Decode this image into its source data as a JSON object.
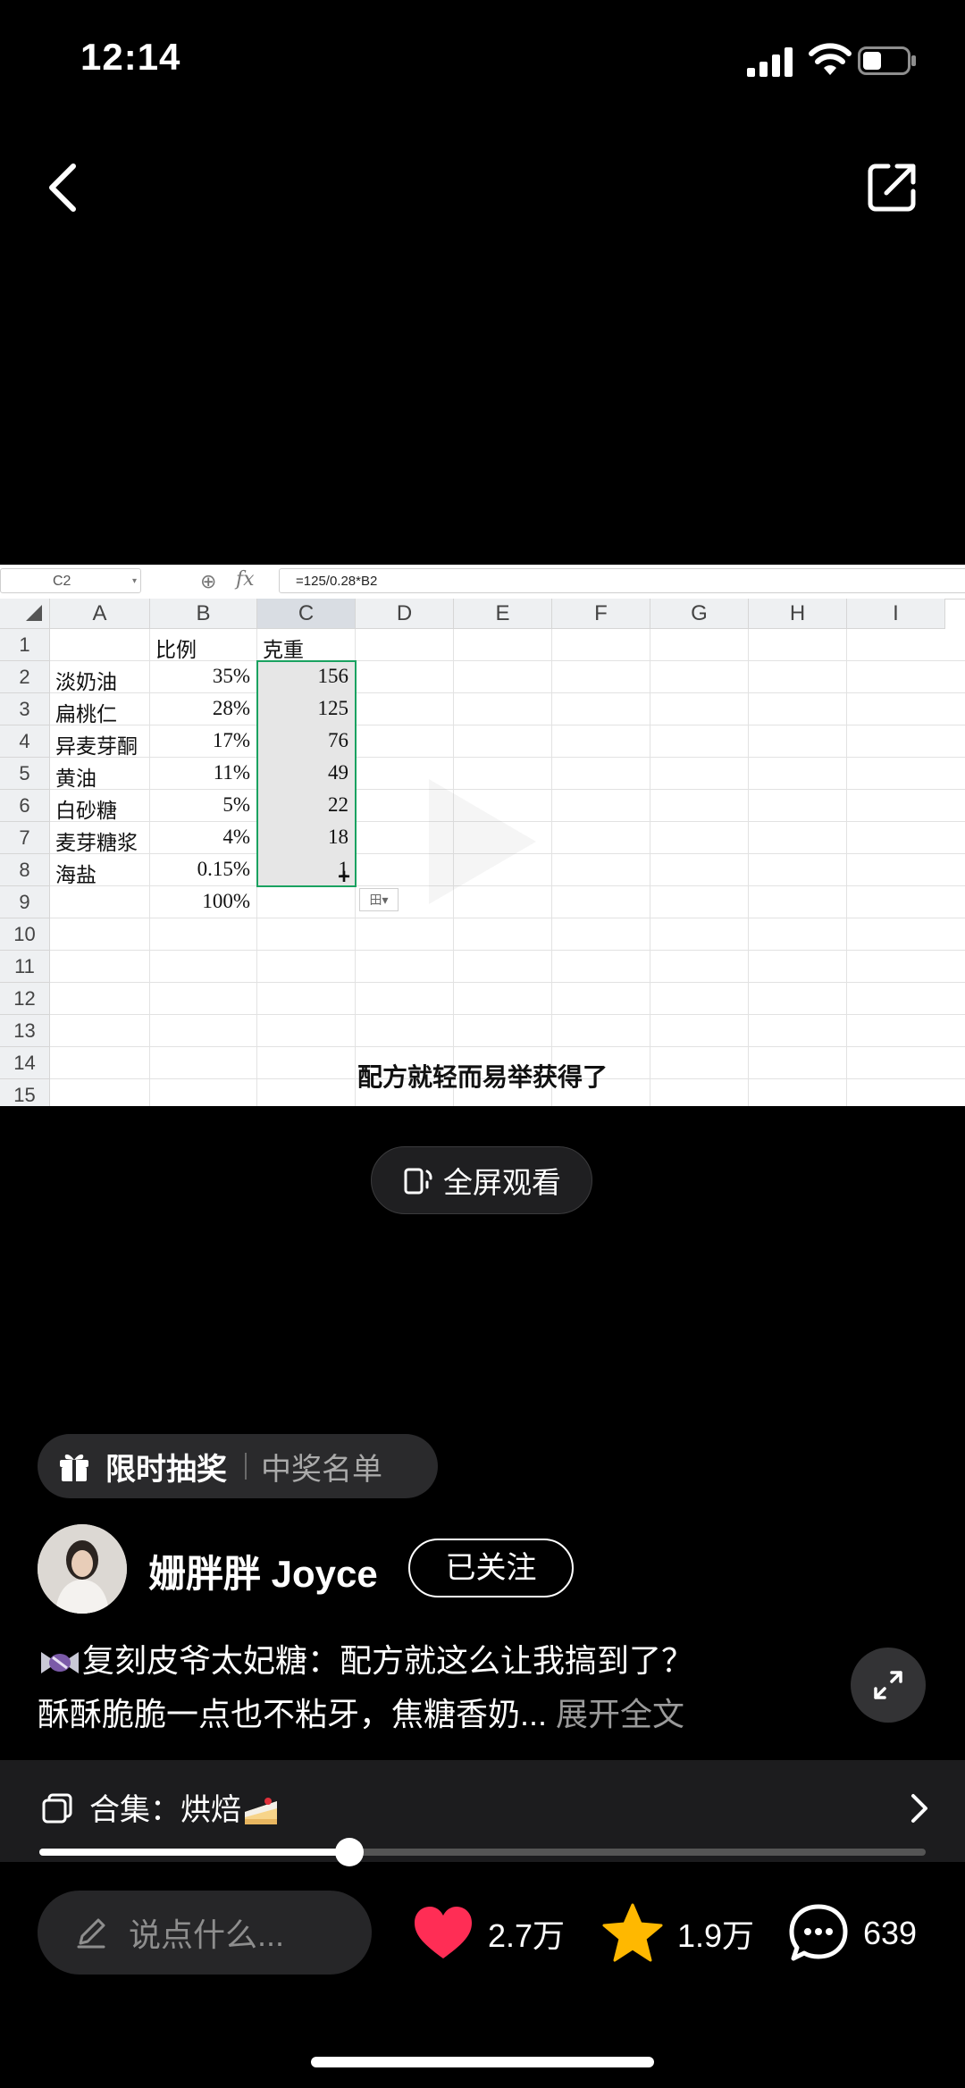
{
  "status": {
    "time": "12:14"
  },
  "sheet": {
    "name_box": "C2",
    "formula": "=125/0.28*B2",
    "fx_label": "fx",
    "columns": [
      "A",
      "B",
      "C",
      "D",
      "E",
      "F",
      "G",
      "H",
      "I"
    ],
    "rows": [
      "1",
      "2",
      "3",
      "4",
      "5",
      "6",
      "7",
      "8",
      "9",
      "10",
      "11",
      "12",
      "13",
      "14",
      "15"
    ],
    "header_row": {
      "b": "比例",
      "c": "克重"
    },
    "data": [
      {
        "a": "淡奶油",
        "b": "35%",
        "c": "156"
      },
      {
        "a": "扁桃仁",
        "b": "28%",
        "c": "125"
      },
      {
        "a": "异麦芽酮",
        "b": "17%",
        "c": "76"
      },
      {
        "a": "黄油",
        "b": "11%",
        "c": "49"
      },
      {
        "a": "白砂糖",
        "b": "5%",
        "c": "22"
      },
      {
        "a": "麦芽糖浆",
        "b": "4%",
        "c": "18"
      },
      {
        "a": "海盐",
        "b": "0.15%",
        "c": "1"
      }
    ],
    "total": "100%",
    "paste_icon": "田▾",
    "caption": "配方就轻而易举获得了"
  },
  "fullscreen_label": "全屏观看",
  "lottery": {
    "label": "限时抽奖",
    "list_label": "中奖名单"
  },
  "author": {
    "name": "姗胖胖 Joyce",
    "follow_label": "已关注"
  },
  "description": {
    "line1": "复刻皮爷太妃糖：配方就这么让我搞到了？",
    "line2": "酥酥脆脆一点也不粘牙，焦糖香奶... ",
    "more": "展开全文"
  },
  "collection": {
    "label": "合集：烘焙"
  },
  "progress": {
    "fraction": 0.35
  },
  "bottom": {
    "comment_placeholder": "说点什么...",
    "likes": "2.7万",
    "favorites": "1.9万",
    "comments": "639"
  },
  "colors": {
    "like": "#ff2d55",
    "star": "#ffb800",
    "selection": "#1aa260"
  }
}
